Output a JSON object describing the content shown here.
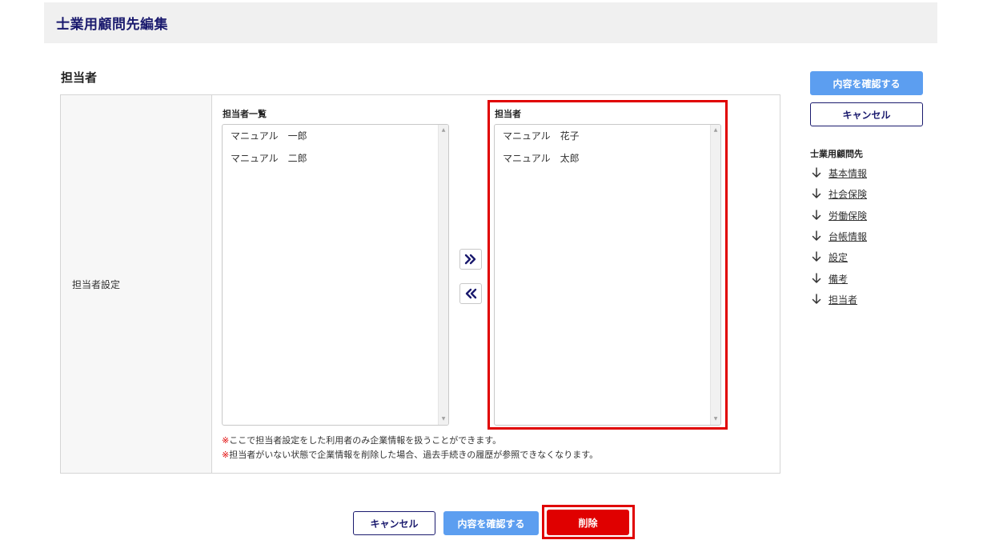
{
  "header": {
    "title": "士業用顧問先編集"
  },
  "section": {
    "title": "担当者"
  },
  "form": {
    "row_label": "担当者設定",
    "available_list": {
      "heading": "担当者一覧",
      "items": [
        "マニュアル　一郎",
        "マニュアル　二郎"
      ]
    },
    "selected_list": {
      "heading": "担当者",
      "items": [
        "マニュアル　花子",
        "マニュアル　太郎"
      ]
    },
    "notes": [
      {
        "mark": "※",
        "text": "ここで担当者設定をした利用者のみ企業情報を扱うことができます。"
      },
      {
        "mark": "※",
        "text": "担当者がいない状態で企業情報を削除した場合、過去手続きの履歴が参照できなくなります。"
      }
    ]
  },
  "sidebar": {
    "confirm_label": "内容を確認する",
    "cancel_label": "キャンセル",
    "nav_title": "士業用顧問先",
    "nav_items": [
      "基本情報",
      "社会保険",
      "労働保険",
      "台帳情報",
      "設定",
      "備考",
      "担当者"
    ]
  },
  "footer": {
    "cancel_label": "キャンセル",
    "confirm_label": "内容を確認する",
    "delete_label": "削除"
  },
  "colors": {
    "primary": "#5c9ef0",
    "navy": "#1a1a6e",
    "danger": "#e00000"
  },
  "icons": {
    "move_right": "double-chevron-right-icon",
    "move_left": "double-chevron-left-icon",
    "nav_arrow": "arrow-down-icon"
  }
}
